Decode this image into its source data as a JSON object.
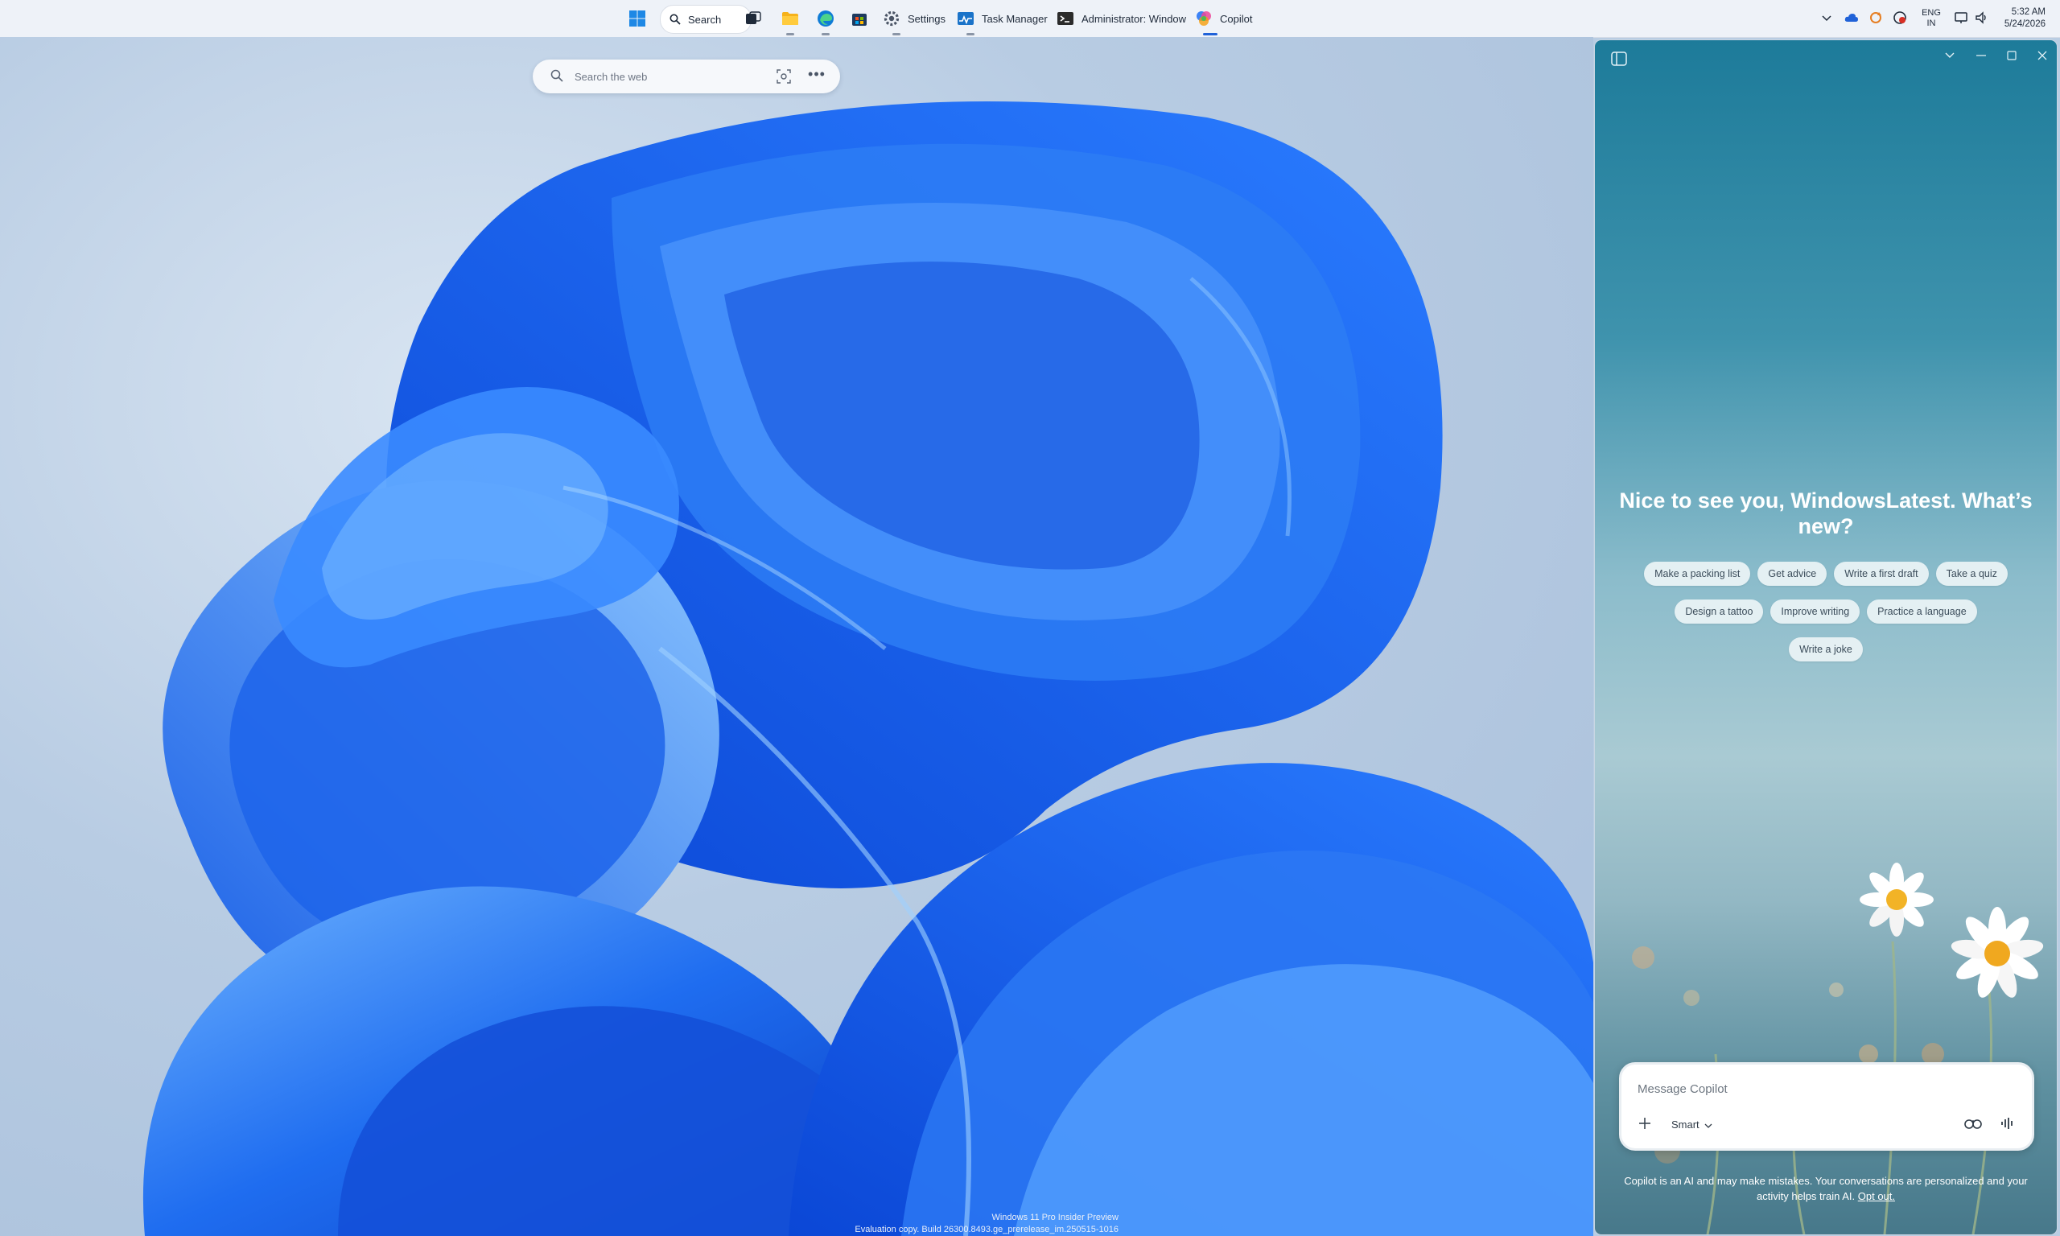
{
  "taskbar": {
    "search_label": "Search",
    "apps": [
      {
        "name": "start",
        "icon": "windows-logo-icon"
      },
      {
        "name": "search",
        "label": "Search",
        "icon": "search-icon"
      },
      {
        "name": "task-view",
        "icon": "task-view-icon"
      },
      {
        "name": "file-explorer",
        "icon": "folder-icon"
      },
      {
        "name": "edge",
        "icon": "edge-icon"
      },
      {
        "name": "store",
        "icon": "store-icon"
      },
      {
        "name": "settings",
        "label": "Settings",
        "icon": "gear-icon"
      },
      {
        "name": "task-manager",
        "label": "Task Manager",
        "icon": "task-manager-icon"
      },
      {
        "name": "terminal",
        "label": "Administrator: Window",
        "icon": "terminal-icon"
      },
      {
        "name": "copilot",
        "label": "Copilot",
        "icon": "copilot-icon"
      }
    ],
    "settings_label": "Settings",
    "taskmanager_label": "Task Manager",
    "terminal_label": "Administrator: Window",
    "copilot_label": "Copilot",
    "tray": {
      "lang_line1": "ENG",
      "lang_line2": "IN",
      "time": "5:32 AM",
      "date": "5/24/2026"
    }
  },
  "desktop": {
    "websearch_placeholder": "Search the web",
    "watermark_line1": "Windows 11 Pro Insider Preview",
    "watermark_line2": "Evaluation copy. Build 26300.8493.ge_prerelease_im.250515-1016"
  },
  "copilot": {
    "greeting": "Nice to see you, WindowsLatest. What’s new?",
    "suggestions_row1": [
      "Make a packing list",
      "Get advice",
      "Write a first draft",
      "Take a quiz"
    ],
    "suggestions_row2": [
      "Design a tattoo",
      "Improve writing",
      "Practice a language"
    ],
    "suggestions_row3": [
      "Write a joke"
    ],
    "message_placeholder": "Message Copilot",
    "mode": "Smart",
    "disclaimer_text": "Copilot is an AI and may make mistakes. Your conversations are personalized and your activity helps train AI.",
    "disclaimer_link": "Opt out."
  },
  "colors": {
    "taskbar_bg": "#eef2f8",
    "accent": "#2062d8",
    "bloom_blue": "#1a5fe6"
  }
}
